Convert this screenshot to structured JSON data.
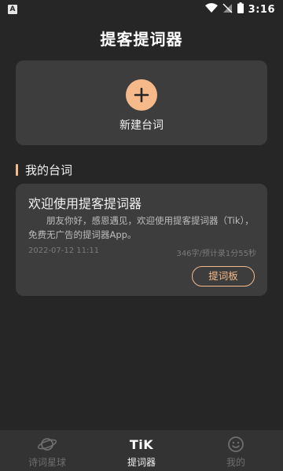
{
  "status_bar": {
    "notification_icon": "A",
    "time": "3:16"
  },
  "header": {
    "title": "提客提词器"
  },
  "new_card": {
    "label": "新建台词",
    "icon": "plus-icon",
    "accent_color": "#f5b98a"
  },
  "section": {
    "title": "我的台词"
  },
  "scripts": [
    {
      "title": "欢迎使用提客提词器",
      "body": "朋友你好，感恩遇见，欢迎使用提客提词器（Tik），免费无广告的提词器App。",
      "date": "2022-07-12 11:11",
      "meta": "346字/预计录1分55秒",
      "action_label": "提词板"
    }
  ],
  "bottom_nav": {
    "items": [
      {
        "label": "诗词星球",
        "icon": "planet-icon",
        "active": false
      },
      {
        "label": "提词器",
        "icon": "tik-logo",
        "logo_text": "TiK",
        "active": true
      },
      {
        "label": "我的",
        "icon": "smiley-icon",
        "active": false
      }
    ]
  },
  "colors": {
    "background": "#262626",
    "card": "#3d3d3d",
    "accent": "#f5b98a",
    "nav_bg": "#333333"
  }
}
